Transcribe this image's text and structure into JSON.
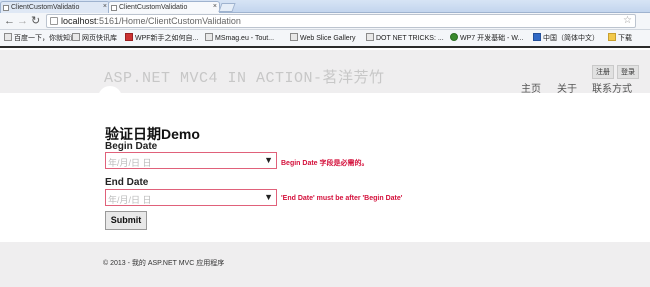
{
  "browser": {
    "tabs": [
      {
        "label": "ClientCustomValidatio",
        "active": false
      },
      {
        "label": "ClientCustomValidatio",
        "active": true
      }
    ],
    "url_host": "localhost",
    "url_path": ":5161/Home/ClientCustomValidation",
    "bookmarks": [
      {
        "label": "百度一下，你就知道",
        "icon": "generic"
      },
      {
        "label": "网页快讯库",
        "icon": "generic"
      },
      {
        "label": "WPF新手之如何自...",
        "icon": "red"
      },
      {
        "label": "MSmag.eu - Tout...",
        "icon": "generic"
      },
      {
        "label": "Web Slice Gallery",
        "icon": "generic"
      },
      {
        "label": "DOT NET TRICKS: ...",
        "icon": "generic"
      },
      {
        "label": "WP7 开发基础 - W...",
        "icon": "green"
      },
      {
        "label": "中国（简体中文）",
        "icon": "windows"
      },
      {
        "label": "下载",
        "icon": "folder"
      }
    ]
  },
  "site": {
    "title": "ASP.NET MVC4 IN ACTION-茗洋芳竹",
    "register": "注册",
    "login": "登录",
    "menu": [
      "主页",
      "关于",
      "联系方式"
    ]
  },
  "form": {
    "heading": "验证日期Demo",
    "begin_label": "Begin Date",
    "begin_placeholder": "年/月/日 日",
    "begin_error": "Begin Date 字段是必需的。",
    "end_label": "End Date",
    "end_placeholder": "年/月/日 日",
    "end_error": "'End Date' must be after 'Begin Date'",
    "submit_label": "Submit"
  },
  "footer": {
    "text": "© 2013 - 我的 ASP.NET MVC 应用程序"
  }
}
